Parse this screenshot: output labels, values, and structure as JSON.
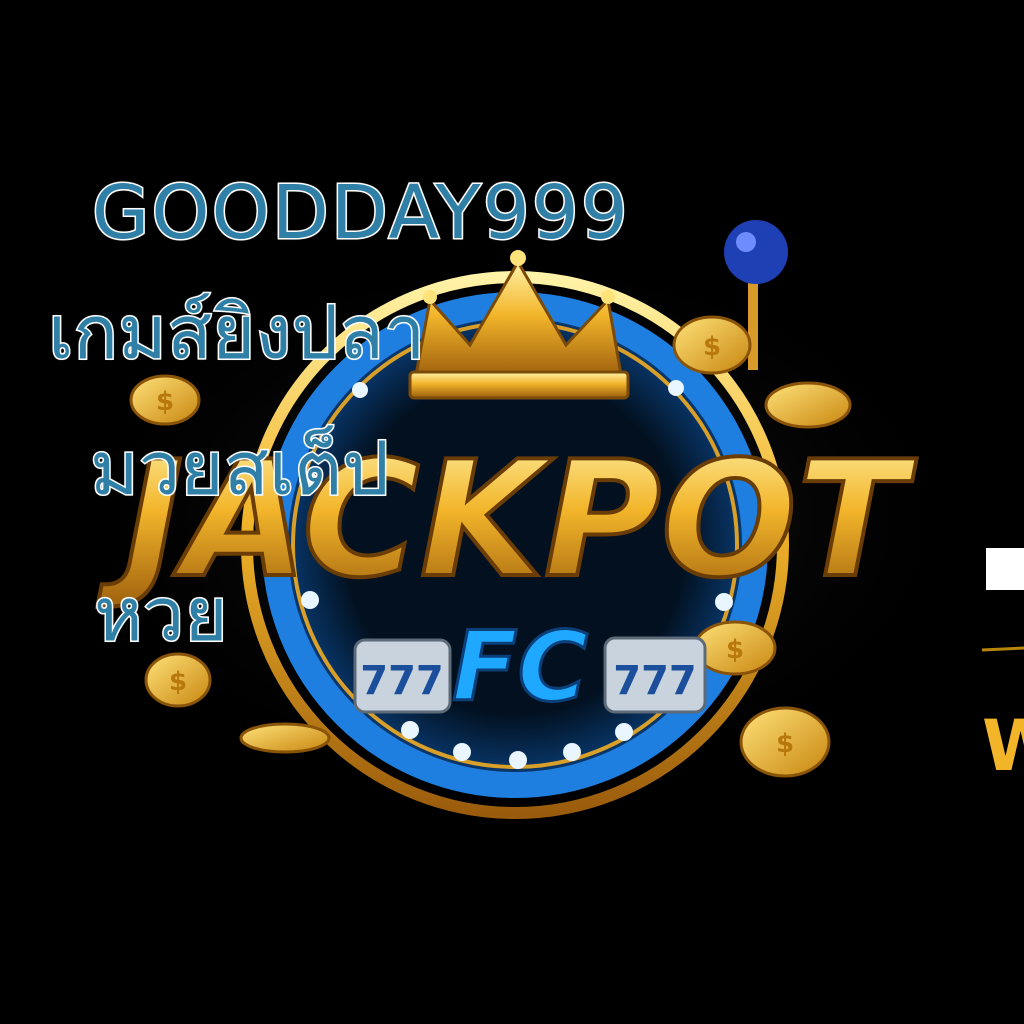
{
  "overlay": {
    "line1": "GOODDAY999",
    "line2": "เกมส์ยิงปลา",
    "line3": "มวยสเต็ป",
    "line4": "หวย"
  },
  "logo": {
    "word": "JACKPOT",
    "sub": "FC",
    "partial_right": "W"
  },
  "colors": {
    "background": "#000000",
    "gold": "#f2b52a",
    "gold_light": "#ffe27a",
    "ring_blue": "#1e7fe0",
    "text_blue": "#2f7fa6",
    "outline_white": "#ffffff",
    "knob_blue": "#1f3fb4"
  },
  "icons": [
    "crown-icon",
    "coin-icon",
    "slot-reel-icon",
    "lever-knob-icon"
  ]
}
